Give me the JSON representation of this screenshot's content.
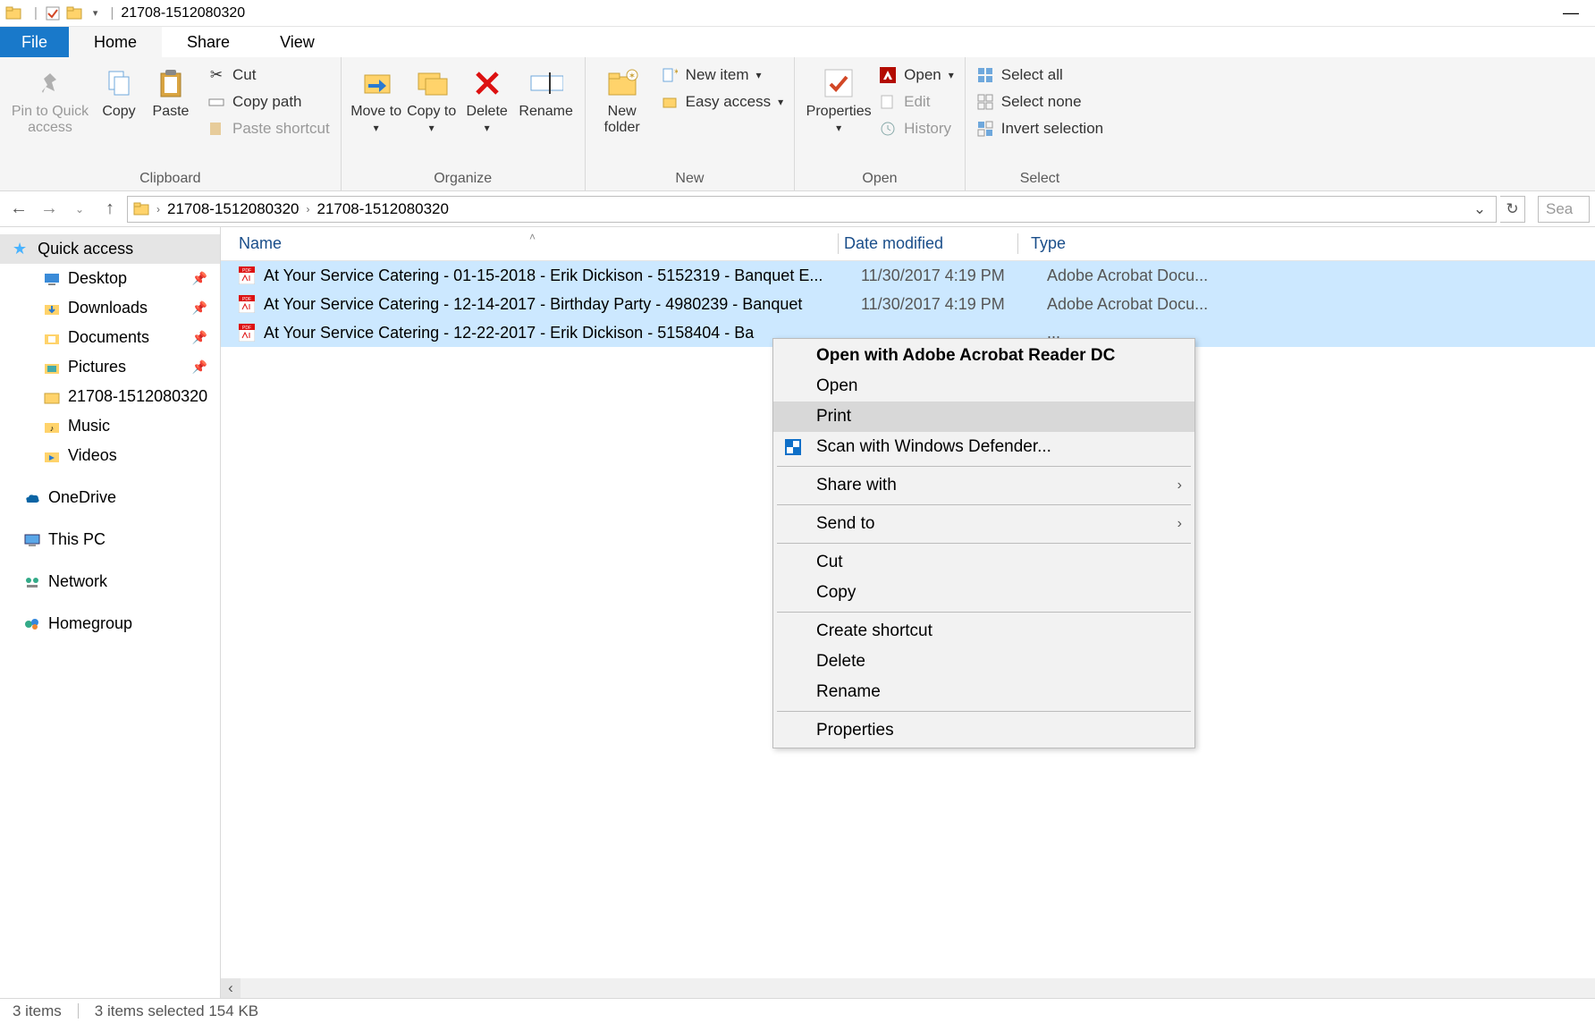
{
  "titlebar": {
    "title": "21708-1512080320"
  },
  "tabs": {
    "file": "File",
    "home": "Home",
    "share": "Share",
    "view": "View"
  },
  "ribbon": {
    "clipboard": {
      "label": "Clipboard",
      "pin": "Pin to Quick access",
      "copy": "Copy",
      "paste": "Paste",
      "cut": "Cut",
      "copypath": "Copy path",
      "pasteshortcut": "Paste shortcut"
    },
    "organize": {
      "label": "Organize",
      "moveto": "Move to",
      "copyto": "Copy to",
      "delete": "Delete",
      "rename": "Rename"
    },
    "new": {
      "label": "New",
      "newfolder": "New folder",
      "newitem": "New item",
      "easyaccess": "Easy access"
    },
    "open": {
      "label": "Open",
      "properties": "Properties",
      "open": "Open",
      "edit": "Edit",
      "history": "History"
    },
    "select": {
      "label": "Select",
      "all": "Select all",
      "none": "Select none",
      "invert": "Invert selection"
    }
  },
  "breadcrumb": {
    "c1": "21708-1512080320",
    "c2": "21708-1512080320"
  },
  "search_placeholder": "Sea",
  "columns": {
    "name": "Name",
    "date": "Date modified",
    "type": "Type"
  },
  "nav": {
    "quickaccess": "Quick access",
    "desktop": "Desktop",
    "downloads": "Downloads",
    "documents": "Documents",
    "pictures": "Pictures",
    "folder": "21708-1512080320",
    "music": "Music",
    "videos": "Videos",
    "onedrive": "OneDrive",
    "thispc": "This PC",
    "network": "Network",
    "homegroup": "Homegroup"
  },
  "files": [
    {
      "name": "At Your Service Catering - 01-15-2018 - Erik Dickison - 5152319 - Banquet E...",
      "date": "11/30/2017 4:19 PM",
      "type": "Adobe Acrobat Docu..."
    },
    {
      "name": "At Your Service Catering - 12-14-2017 - Birthday Party - 4980239 - Banquet",
      "date": "11/30/2017 4:19 PM",
      "type": "Adobe Acrobat Docu..."
    },
    {
      "name": "At Your Service Catering - 12-22-2017 - Erik Dickison - 5158404 - Ba",
      "date": "",
      "type": "..."
    }
  ],
  "context": {
    "openwith": "Open with Adobe Acrobat Reader DC",
    "open": "Open",
    "print": "Print",
    "scan": "Scan with Windows Defender...",
    "sharewith": "Share with",
    "sendto": "Send to",
    "cut": "Cut",
    "copy": "Copy",
    "createshortcut": "Create shortcut",
    "delete": "Delete",
    "rename": "Rename",
    "properties": "Properties"
  },
  "status": {
    "items": "3 items",
    "selected": "3 items selected  154 KB"
  }
}
